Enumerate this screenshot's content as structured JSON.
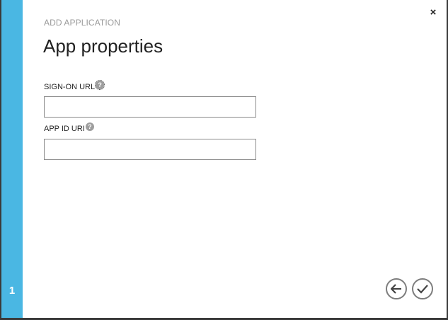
{
  "wizard": {
    "step_number": "1",
    "breadcrumb": "ADD APPLICATION",
    "title": "App properties",
    "close_glyph": "×"
  },
  "fields": [
    {
      "label": "SIGN-ON URL",
      "value": "",
      "help_icon": "question-icon",
      "help_glyph": "?"
    },
    {
      "label": "APP ID URI",
      "value": "",
      "help_icon": "question-icon",
      "help_glyph": "?"
    }
  ],
  "buttons": {
    "back_icon": "arrow-left-icon",
    "complete_icon": "checkmark-icon"
  },
  "colors": {
    "accent": "#4ab7e3",
    "background": "#ffffff",
    "help": "#9e9e9e"
  }
}
